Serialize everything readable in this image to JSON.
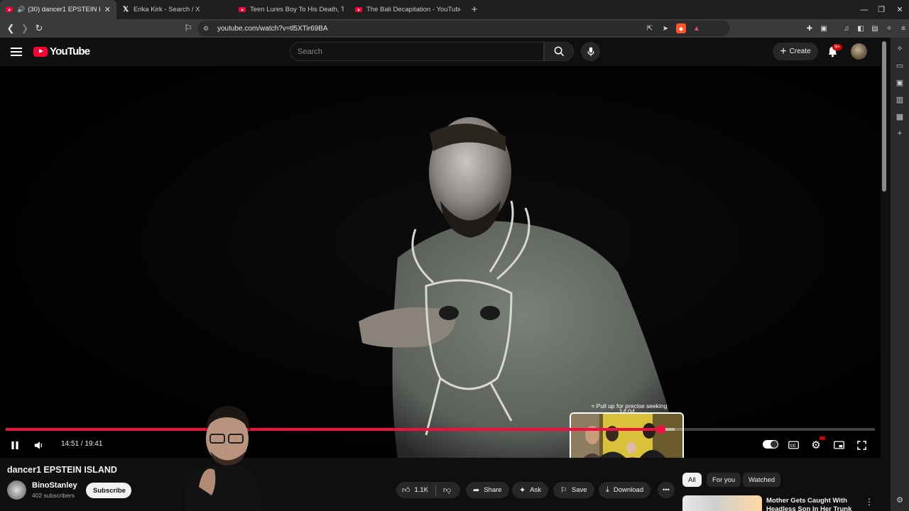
{
  "browser": {
    "tabs": [
      {
        "title": "(30) dancer1 EPSTEIN ISLAND",
        "icon": "youtube-icon",
        "active": true
      },
      {
        "title": "Erika Kirk - Search / X",
        "icon": "x-icon",
        "active": false
      },
      {
        "title": "Teen Lures Boy To His Death, Th",
        "icon": "youtube-icon",
        "active": false
      },
      {
        "title": "The Bali Decapitation - YouTube",
        "icon": "youtube-icon",
        "active": false
      }
    ],
    "url": "youtube.com/watch?v=tl5XTir69BA"
  },
  "masthead": {
    "logo_text": "YouTube",
    "search_placeholder": "Search",
    "create_label": "Create",
    "notification_count": "9+"
  },
  "player": {
    "seek_hint": "Pull up for precise seeking",
    "preview_time": "14:04",
    "current_time": "14:51",
    "duration": "19:41",
    "time_display": "14:51 / 19:41",
    "progress_fraction": 0.754,
    "buffered_fraction": 0.77,
    "hover_fraction": 0.715,
    "autoplay": true
  },
  "video_info": {
    "title": "dancer1 EPSTEIN ISLAND",
    "channel_name": "BinoStanley",
    "subscribers": "402 subscribers",
    "subscribe_label": "Subscribe",
    "likes": "1.1K",
    "actions": {
      "share": "Share",
      "ask": "Ask",
      "save": "Save",
      "download": "Download"
    }
  },
  "sidebar": {
    "chips": [
      "All",
      "For you",
      "Watched"
    ],
    "active_chip": "All",
    "recommendation_title": "Mother Gets Caught With Headless Son In Her Trunk"
  },
  "colors": {
    "accent": "#f20f3f",
    "background": "#0f0f0f",
    "youtube_red": "#ff0033"
  }
}
